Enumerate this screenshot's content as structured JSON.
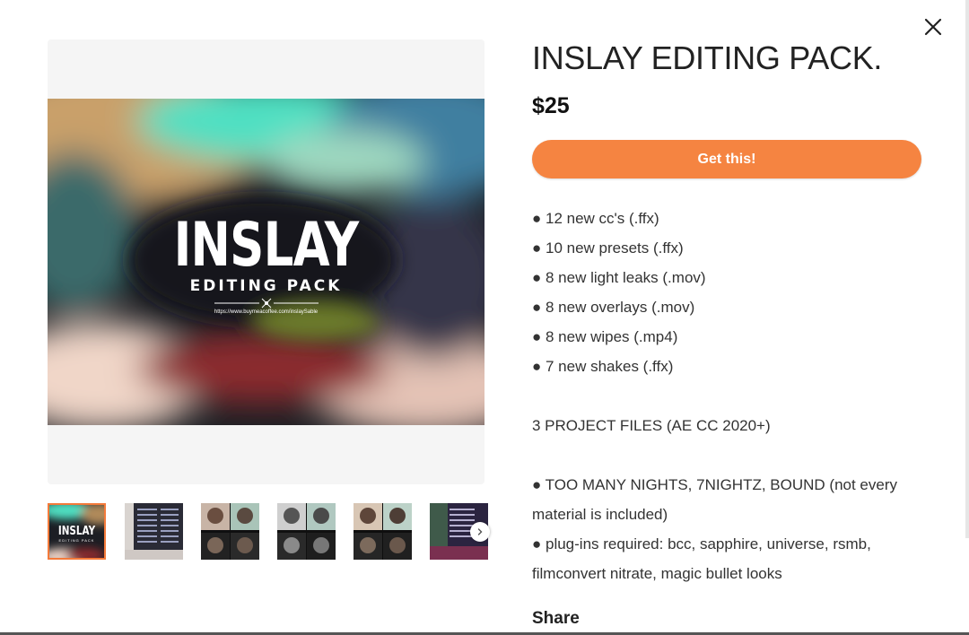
{
  "modal": {
    "close_label": "×",
    "close_icon": "close-icon"
  },
  "gallery": {
    "cover": {
      "title": "INSLAY",
      "subtitle": "EDITING PACK",
      "url": "https://www.buymeacoffee.com/inslaySable"
    },
    "thumbnails": [
      {
        "name": "INSLAY cover",
        "caption": "INSLAY",
        "sub": "EDITING PACK"
      },
      {
        "name": "plug-in list"
      },
      {
        "name": "portrait preview 1"
      },
      {
        "name": "portrait preview 2"
      },
      {
        "name": "portrait preview 3"
      },
      {
        "name": "file list preview"
      }
    ],
    "next_icon": "chevron-right-icon",
    "next_label": "›"
  },
  "product": {
    "title": "INSLAY EDITING PACK.",
    "price": "$25",
    "buy_label": "Get this!",
    "description": [
      "● 12 new cc's (.ffx)",
      "● 10 new presets (.ffx)",
      "● 8 new light leaks (.mov)",
      "● 8 new overlays (.mov)",
      "● 8 new wipes (.mp4)",
      "● 7 new shakes (.ffx)",
      "",
      "3 PROJECT FILES (AE CC 2020+)",
      "",
      "● TOO MANY NIGHTS, 7NIGHTZ, BOUND (not every material is included)",
      "● plug-ins required: bcc, sapphire, universe, rsmb, filmconvert nitrate, magic bullet looks"
    ],
    "share_label": "Share"
  },
  "colors": {
    "accent": "#f58441",
    "active_thumb_border": "#f47a3a"
  }
}
